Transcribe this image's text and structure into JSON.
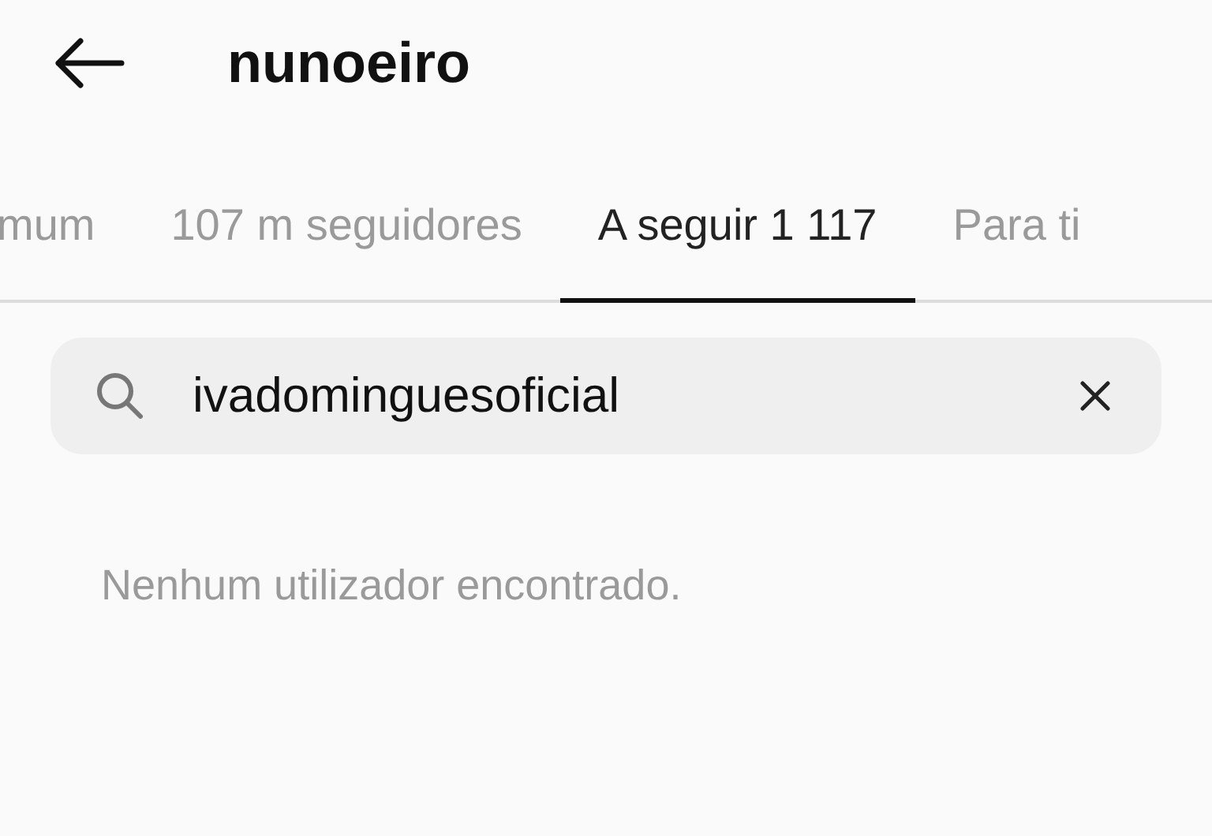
{
  "header": {
    "title": "nunoeiro"
  },
  "tabs": [
    {
      "label": "mum",
      "selected": false
    },
    {
      "label": "107 m seguidores",
      "selected": false
    },
    {
      "label": "A seguir 1 117",
      "selected": true
    },
    {
      "label": "Para ti",
      "selected": false
    }
  ],
  "search": {
    "value": "ivadominguesoficial"
  },
  "message": "Nenhum utilizador encontrado."
}
